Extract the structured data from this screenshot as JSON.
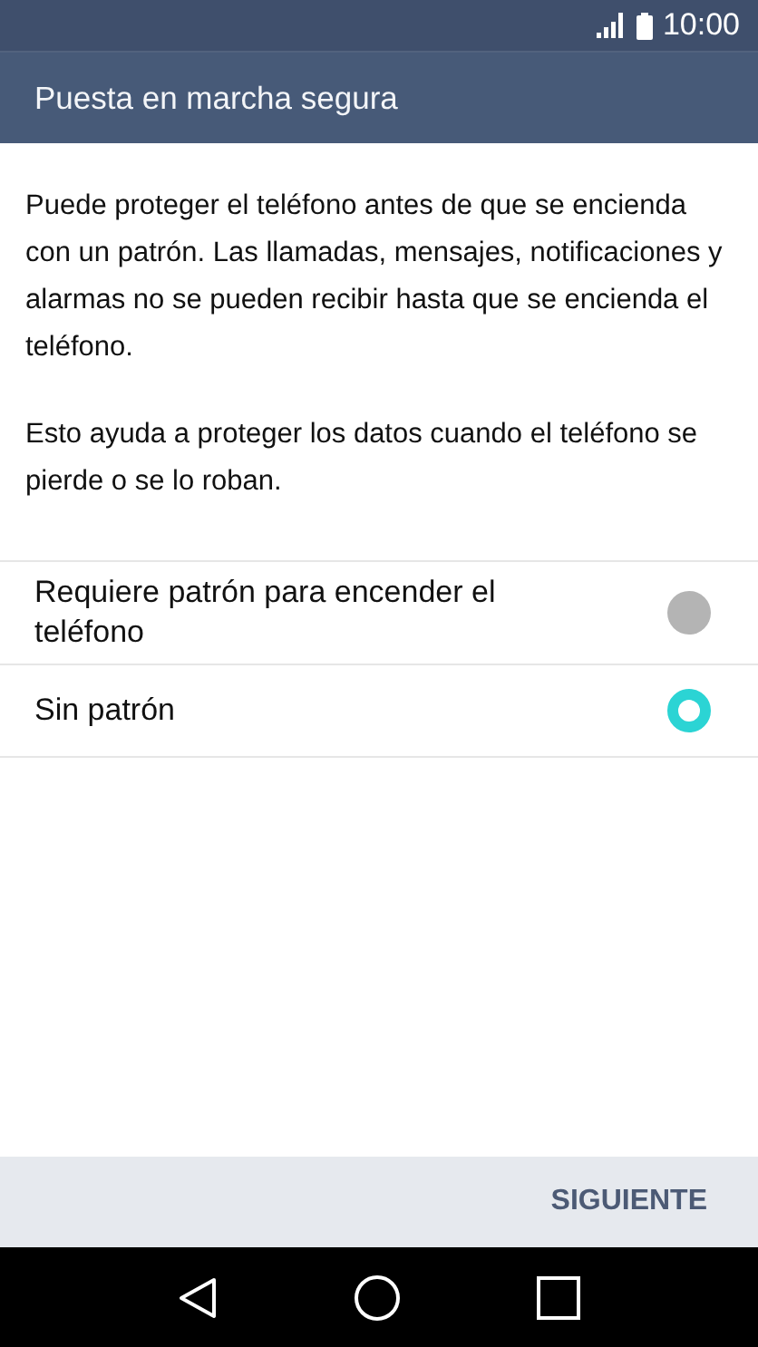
{
  "status_bar": {
    "time": "10:00"
  },
  "title": "Puesta en marcha segura",
  "paragraphs": [
    "Puede proteger el teléfono antes de que se encienda con un patrón. Las llamadas, mensajes, notificaciones y alarmas no se pueden recibir hasta que se encienda el teléfono.",
    "Esto ayuda a proteger los datos cuando el teléfono se pierde o se lo roban."
  ],
  "options": [
    {
      "label": "Requiere patrón para encender el teléfono",
      "selected": false
    },
    {
      "label": "Sin patrón",
      "selected": true
    }
  ],
  "footer": {
    "next_button": "SIGUIENTE"
  }
}
